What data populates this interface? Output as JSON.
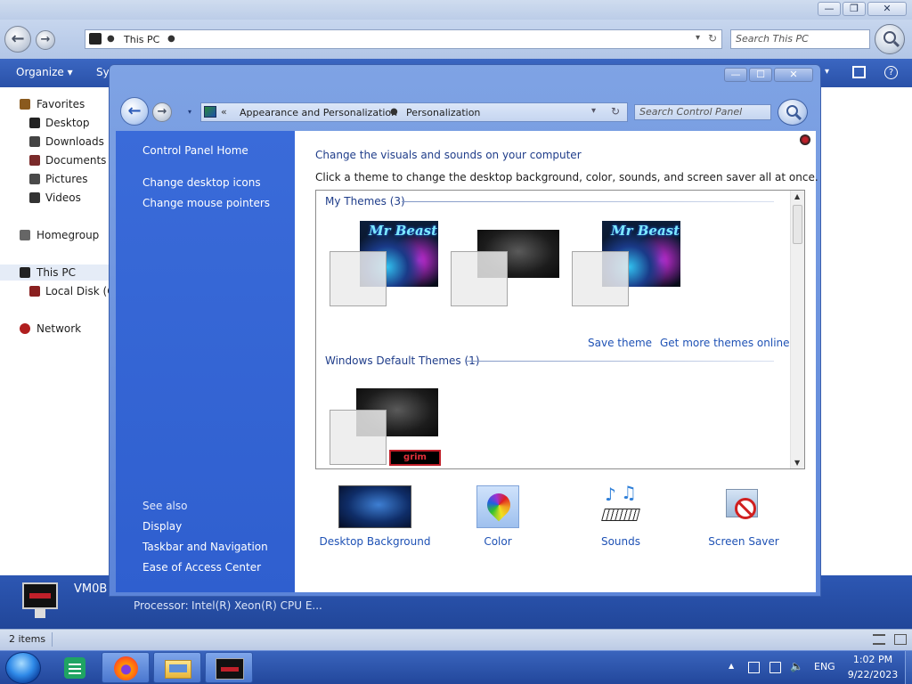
{
  "explorer": {
    "controls": {
      "minimize": "—",
      "maximize": "❐",
      "close": "✕"
    },
    "address": {
      "crumb": "This PC",
      "separator": "●"
    },
    "search_placeholder": "Search This PC",
    "toolbar": {
      "organize": "Organize ▾",
      "system_partial": "Sy"
    },
    "nav": {
      "favorites": "Favorites",
      "desktop": "Desktop",
      "downloads": "Downloads",
      "documents": "Documents",
      "pictures": "Pictures",
      "videos": "Videos",
      "homegroup": "Homegroup",
      "this_pc": "This PC",
      "local_disk": "Local Disk (C:)",
      "network": "Network"
    },
    "details": {
      "pc_name_partial": "VM0B",
      "processor_label": "Processor:",
      "processor_value": "Intel(R) Xeon(R) CPU E..."
    },
    "status": {
      "items": "2 items"
    }
  },
  "control_panel": {
    "controls": {
      "minimize": "—",
      "maximize": "☐",
      "close": "✕"
    },
    "address": {
      "chevron": "«",
      "crumb1": "Appearance and Personalization",
      "separator": "●",
      "crumb2": "Personalization"
    },
    "search_placeholder": "Search Control Panel",
    "sidebar": {
      "home": "Control Panel Home",
      "desktop_icons": "Change desktop icons",
      "mouse_pointers": "Change mouse pointers",
      "see_also": "See also",
      "display": "Display",
      "taskbar_nav": "Taskbar and Navigation",
      "ease_of_access": "Ease of Access Center"
    },
    "heading": "Change the visuals and sounds on your computer",
    "subheading": "Click a theme to change the desktop background, color, sounds, and screen saver all at once.",
    "themes": {
      "my_themes_header": "My Themes (3)",
      "default_themes_header": "Windows Default Themes (1)",
      "beast_title": "Mr Beast",
      "grim_label": "grim",
      "save_theme": "Save theme",
      "get_more": "Get more themes online"
    },
    "bottom": {
      "desktop_background": "Desktop Background",
      "color": "Color",
      "sounds": "Sounds",
      "screen_saver": "Screen Saver"
    }
  },
  "taskbar": {
    "tray": {
      "show_hidden": "▲",
      "volume": "🔈",
      "language": "ENG",
      "time": "1:02 PM",
      "date": "9/22/2023"
    }
  }
}
